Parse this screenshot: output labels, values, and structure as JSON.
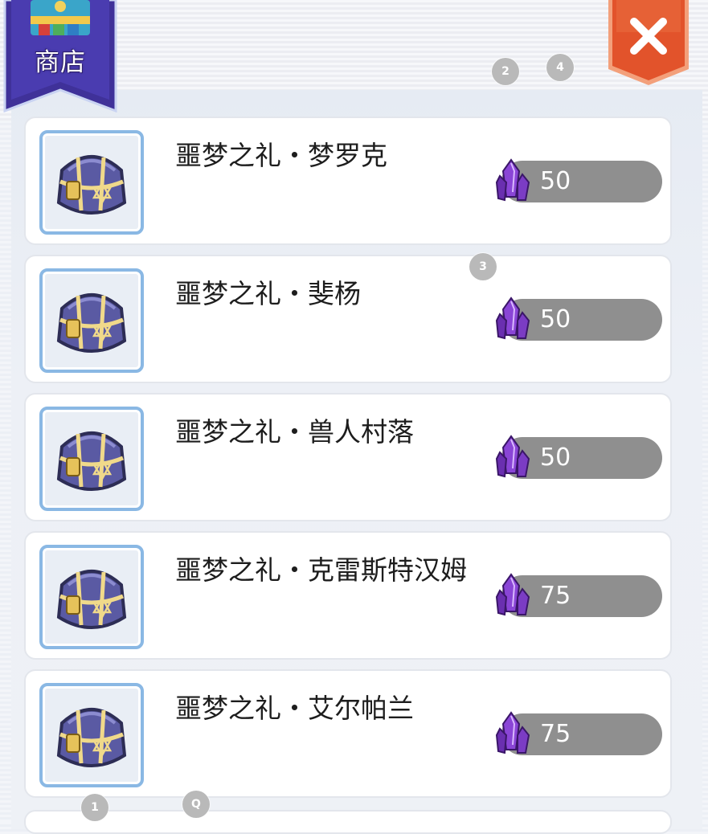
{
  "header": {
    "shop_title": "商店",
    "close_icon": "close-x-icon"
  },
  "markers": {
    "m1": "1",
    "m2": "2",
    "m3": "3",
    "m4": "4",
    "mq": "Q"
  },
  "currency": {
    "icon": "purple-crystal-icon",
    "color": "#7a3cc2"
  },
  "items": [
    {
      "name": "噩梦之礼・梦罗克",
      "price": "50",
      "icon": "treasure-chest-icon"
    },
    {
      "name": "噩梦之礼・斐杨",
      "price": "50",
      "icon": "treasure-chest-icon"
    },
    {
      "name": "噩梦之礼・兽人村落",
      "price": "50",
      "icon": "treasure-chest-icon"
    },
    {
      "name": "噩梦之礼・克雷斯特汉姆",
      "price": "75",
      "icon": "treasure-chest-icon"
    },
    {
      "name": "噩梦之礼・艾尔帕兰",
      "price": "75",
      "icon": "treasure-chest-icon"
    }
  ],
  "colors": {
    "banner": "#3f3199",
    "close_button": "#e2532b",
    "price_pill": "#8f8f8f",
    "icon_frame": "#8ab8e4"
  }
}
